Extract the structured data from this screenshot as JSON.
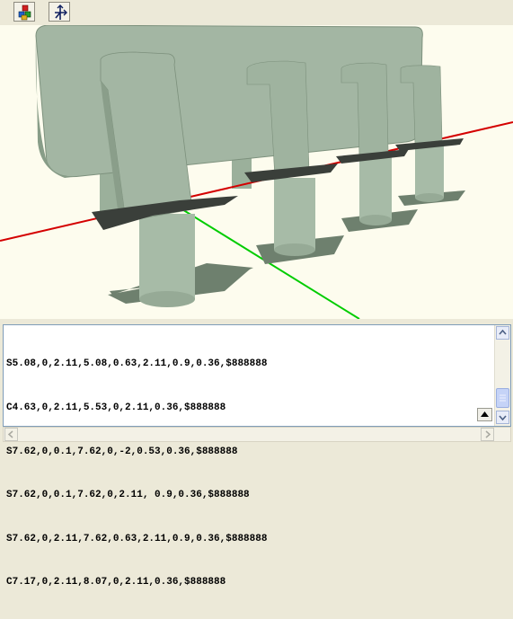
{
  "toolbar": {
    "buttons": [
      {
        "name": "view-cubes-icon"
      },
      {
        "name": "fit-axes-icon"
      }
    ]
  },
  "viewport": {
    "background": "#fdfcee",
    "body_color": "#a7b9a7",
    "axis_colors": {
      "x": "#d40000",
      "y": "#00cc00",
      "z": "#0000cc"
    }
  },
  "code": {
    "lines": [
      "S5.08,0,2.11,5.08,0.63,2.11,0.9,0.36,$888888",
      "C4.63,0,2.11,5.53,0,2.11,0.36,$888888",
      "S7.62,0,0.1,7.62,0,-2,0.53,0.36,$888888",
      "S7.62,0,0.1,7.62,0,2.11, 0.9,0.36,$888888",
      "S7.62,0,2.11,7.62,0.63,2.11,0.9,0.36,$888888",
      "C7.17,0,2.11,8.07,0,2.11,0.36,$888888"
    ]
  }
}
